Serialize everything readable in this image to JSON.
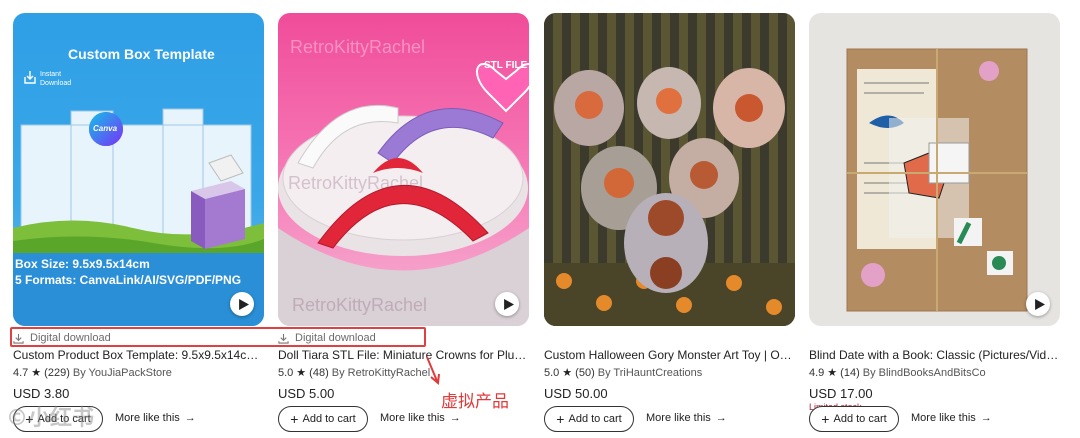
{
  "products": [
    {
      "image_alt": "Custom Box Template",
      "img_texts": {
        "header": "Custom Box Template",
        "instant": "Instant\nDownload",
        "canva": "Canva",
        "size": "Box Size: 9.5x9.5x14cm",
        "formats": "5 Formats: CanvaLink/AI/SVG/PDF/PNG"
      },
      "badge": "Digital download",
      "title": "Custom Product Box Template: 9.5x9.5x14cm (...",
      "rating": "4.7",
      "reviews": "(229)",
      "shop": "By YouJiaPackStore",
      "price": "USD 3.80",
      "add_to_cart": "Add to cart",
      "more_like_this": "More like this"
    },
    {
      "image_alt": "Doll tiara STL",
      "img_texts": {
        "wm1": "RetroKittyRachel",
        "wm2": "RetroKittyRachel",
        "wm3": "RetroKittyRachel",
        "heart": "STL FILE"
      },
      "badge": "Digital download",
      "title": "Doll Tiara STL File: Miniature Crowns for Plush ...",
      "rating": "5.0",
      "reviews": "(48)",
      "shop": "By RetroKittyRachel",
      "price": "USD 5.00",
      "add_to_cart": "Add to cart",
      "more_like_this": "More like this"
    },
    {
      "image_alt": "Halloween gory monster art toys",
      "badge": "",
      "title": "Custom Halloween Gory Monster Art Toy | OO...",
      "rating": "5.0",
      "reviews": "(50)",
      "shop": "By TriHauntCreations",
      "price": "USD 50.00",
      "add_to_cart": "Add to cart",
      "more_like_this": "More like this"
    },
    {
      "image_alt": "Blind date with a book wrapped",
      "badge": "",
      "title": "Blind Date with a Book: Classic (Pictures/Vide...",
      "rating": "4.9",
      "reviews": "(14)",
      "shop": "By BlindBooksAndBitsCo",
      "price": "USD 17.00",
      "limited": "Limited stock",
      "add_to_cart": "Add to cart",
      "more_like_this": "More like this"
    }
  ],
  "annotation": "虚拟产品",
  "watermark": "©小红书",
  "colors": {
    "highlight": "#e04040",
    "limited": "#a61a2e",
    "box_bg": "#2a9be0"
  }
}
